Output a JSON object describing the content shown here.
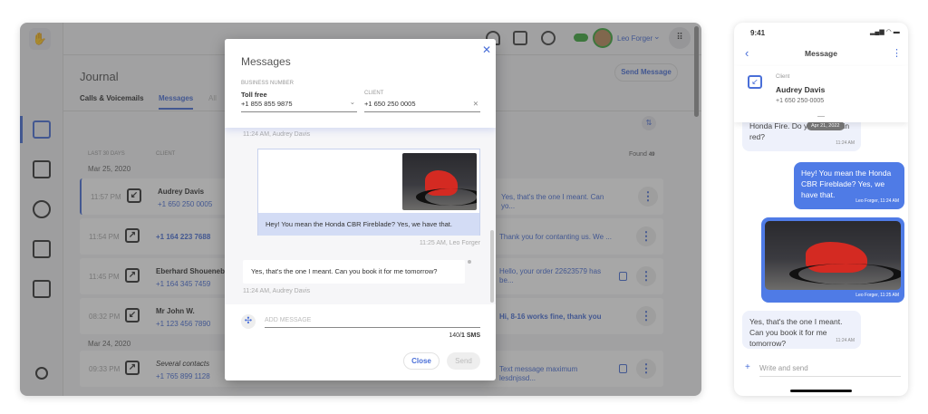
{
  "app": {
    "journal_title": "Journal",
    "tabs": [
      "Calls & Voicemails",
      "Messages",
      "All"
    ],
    "send_message": "Send Message",
    "user": "Leo Forger",
    "filter_label": "LAST 30 DAYS",
    "client_col": "CLIENT",
    "found_label": "Found",
    "found_count": "49",
    "groups": [
      {
        "date": "Mar 25, 2020",
        "rows": [
          {
            "time": "11:57 PM",
            "direction": "incoming",
            "name": "Audrey Davis",
            "phone": "+1 650 250 0005",
            "message": "Yes, that's the one I meant. Can yo...",
            "note": false
          },
          {
            "time": "11:54 PM",
            "direction": "outgoing",
            "name": "",
            "phone": "+1 164 223 7688",
            "message": "Thank you for contanting us.  We ...",
            "note": false
          },
          {
            "time": "11:45 PM",
            "direction": "outgoing",
            "name": "Eberhard Shoueneber",
            "phone": "+1 164 345 7459",
            "message": "Hello, your order 22623579 has be...",
            "note": true
          },
          {
            "time": "08:32 PM",
            "direction": "incoming",
            "name": "Mr John W.",
            "phone": "+1 123 456 7890",
            "message": "Hi, 8-16 works fine, thank you",
            "note": false
          }
        ]
      },
      {
        "date": "Mar 24, 2020",
        "rows": [
          {
            "time": "09:33 PM",
            "direction": "outgoing",
            "name": "Several contacts",
            "phone": "+1 765 899 1128",
            "message": "Text message maximum lesdnjssd...",
            "note": true
          }
        ]
      }
    ]
  },
  "modal": {
    "title": "Messages",
    "business_label": "BUSINESS NUMBER",
    "business_type": "Toll free",
    "business_number": "+1 855 855 9875",
    "client_label": "CLIENT",
    "client_number": "+1 650 250 0005",
    "top_meta": "11:24 AM, Audrey Davis",
    "out_text": "Hey! You mean the Honda CBR Fireblade? Yes, we have that.",
    "out_meta": "11:25 AM, Leo Forger",
    "in_text": "Yes, that's the one I meant. Can you book it for me tomorrow?",
    "in_meta": "11:24 AM, Audrey Davis",
    "input_placeholder": "ADD MESSAGE",
    "counter": "140/",
    "counter_sms": "1 SMS",
    "close": "Close",
    "send": "Send"
  },
  "phone": {
    "time": "9:41",
    "title": "Message",
    "client_label": "Client",
    "client_name": "Audrey Davis",
    "client_phone": "+1 650 250-0005",
    "date_chip": "Apr 21, 2022",
    "msg1": "Hi. I'm interested in renting a Honda Fire. Do you have it in red?",
    "msg1_time": "11:24 AM",
    "msg2": "Hey! You mean the Honda CBR Fireblade? Yes, we have that.",
    "msg2_meta": "Leo Forger, 11:24 AM",
    "img_meta": "Leo Forger, 11:25 AM",
    "msg3": "Yes, that's the one I meant. Can you book it for me tomorrow?",
    "msg3_time": "11:24 AM",
    "input_placeholder": "Write and send"
  },
  "colors": {
    "accent": "#4a6fd8",
    "bubble_out": "#4f7be6",
    "bubble_in": "#eef1fb"
  }
}
